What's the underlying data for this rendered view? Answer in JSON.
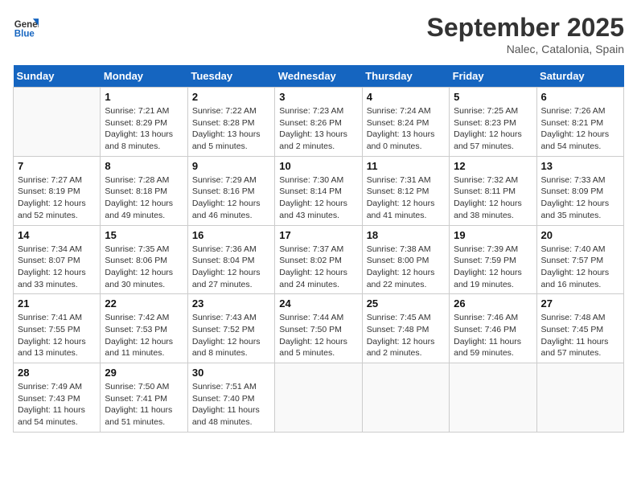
{
  "header": {
    "logo_line1": "General",
    "logo_line2": "Blue",
    "month_title": "September 2025",
    "location": "Nalec, Catalonia, Spain"
  },
  "weekdays": [
    "Sunday",
    "Monday",
    "Tuesday",
    "Wednesday",
    "Thursday",
    "Friday",
    "Saturday"
  ],
  "weeks": [
    [
      {
        "day": "",
        "info": ""
      },
      {
        "day": "1",
        "info": "Sunrise: 7:21 AM\nSunset: 8:29 PM\nDaylight: 13 hours\nand 8 minutes."
      },
      {
        "day": "2",
        "info": "Sunrise: 7:22 AM\nSunset: 8:28 PM\nDaylight: 13 hours\nand 5 minutes."
      },
      {
        "day": "3",
        "info": "Sunrise: 7:23 AM\nSunset: 8:26 PM\nDaylight: 13 hours\nand 2 minutes."
      },
      {
        "day": "4",
        "info": "Sunrise: 7:24 AM\nSunset: 8:24 PM\nDaylight: 13 hours\nand 0 minutes."
      },
      {
        "day": "5",
        "info": "Sunrise: 7:25 AM\nSunset: 8:23 PM\nDaylight: 12 hours\nand 57 minutes."
      },
      {
        "day": "6",
        "info": "Sunrise: 7:26 AM\nSunset: 8:21 PM\nDaylight: 12 hours\nand 54 minutes."
      }
    ],
    [
      {
        "day": "7",
        "info": "Sunrise: 7:27 AM\nSunset: 8:19 PM\nDaylight: 12 hours\nand 52 minutes."
      },
      {
        "day": "8",
        "info": "Sunrise: 7:28 AM\nSunset: 8:18 PM\nDaylight: 12 hours\nand 49 minutes."
      },
      {
        "day": "9",
        "info": "Sunrise: 7:29 AM\nSunset: 8:16 PM\nDaylight: 12 hours\nand 46 minutes."
      },
      {
        "day": "10",
        "info": "Sunrise: 7:30 AM\nSunset: 8:14 PM\nDaylight: 12 hours\nand 43 minutes."
      },
      {
        "day": "11",
        "info": "Sunrise: 7:31 AM\nSunset: 8:12 PM\nDaylight: 12 hours\nand 41 minutes."
      },
      {
        "day": "12",
        "info": "Sunrise: 7:32 AM\nSunset: 8:11 PM\nDaylight: 12 hours\nand 38 minutes."
      },
      {
        "day": "13",
        "info": "Sunrise: 7:33 AM\nSunset: 8:09 PM\nDaylight: 12 hours\nand 35 minutes."
      }
    ],
    [
      {
        "day": "14",
        "info": "Sunrise: 7:34 AM\nSunset: 8:07 PM\nDaylight: 12 hours\nand 33 minutes."
      },
      {
        "day": "15",
        "info": "Sunrise: 7:35 AM\nSunset: 8:06 PM\nDaylight: 12 hours\nand 30 minutes."
      },
      {
        "day": "16",
        "info": "Sunrise: 7:36 AM\nSunset: 8:04 PM\nDaylight: 12 hours\nand 27 minutes."
      },
      {
        "day": "17",
        "info": "Sunrise: 7:37 AM\nSunset: 8:02 PM\nDaylight: 12 hours\nand 24 minutes."
      },
      {
        "day": "18",
        "info": "Sunrise: 7:38 AM\nSunset: 8:00 PM\nDaylight: 12 hours\nand 22 minutes."
      },
      {
        "day": "19",
        "info": "Sunrise: 7:39 AM\nSunset: 7:59 PM\nDaylight: 12 hours\nand 19 minutes."
      },
      {
        "day": "20",
        "info": "Sunrise: 7:40 AM\nSunset: 7:57 PM\nDaylight: 12 hours\nand 16 minutes."
      }
    ],
    [
      {
        "day": "21",
        "info": "Sunrise: 7:41 AM\nSunset: 7:55 PM\nDaylight: 12 hours\nand 13 minutes."
      },
      {
        "day": "22",
        "info": "Sunrise: 7:42 AM\nSunset: 7:53 PM\nDaylight: 12 hours\nand 11 minutes."
      },
      {
        "day": "23",
        "info": "Sunrise: 7:43 AM\nSunset: 7:52 PM\nDaylight: 12 hours\nand 8 minutes."
      },
      {
        "day": "24",
        "info": "Sunrise: 7:44 AM\nSunset: 7:50 PM\nDaylight: 12 hours\nand 5 minutes."
      },
      {
        "day": "25",
        "info": "Sunrise: 7:45 AM\nSunset: 7:48 PM\nDaylight: 12 hours\nand 2 minutes."
      },
      {
        "day": "26",
        "info": "Sunrise: 7:46 AM\nSunset: 7:46 PM\nDaylight: 11 hours\nand 59 minutes."
      },
      {
        "day": "27",
        "info": "Sunrise: 7:48 AM\nSunset: 7:45 PM\nDaylight: 11 hours\nand 57 minutes."
      }
    ],
    [
      {
        "day": "28",
        "info": "Sunrise: 7:49 AM\nSunset: 7:43 PM\nDaylight: 11 hours\nand 54 minutes."
      },
      {
        "day": "29",
        "info": "Sunrise: 7:50 AM\nSunset: 7:41 PM\nDaylight: 11 hours\nand 51 minutes."
      },
      {
        "day": "30",
        "info": "Sunrise: 7:51 AM\nSunset: 7:40 PM\nDaylight: 11 hours\nand 48 minutes."
      },
      {
        "day": "",
        "info": ""
      },
      {
        "day": "",
        "info": ""
      },
      {
        "day": "",
        "info": ""
      },
      {
        "day": "",
        "info": ""
      }
    ]
  ]
}
